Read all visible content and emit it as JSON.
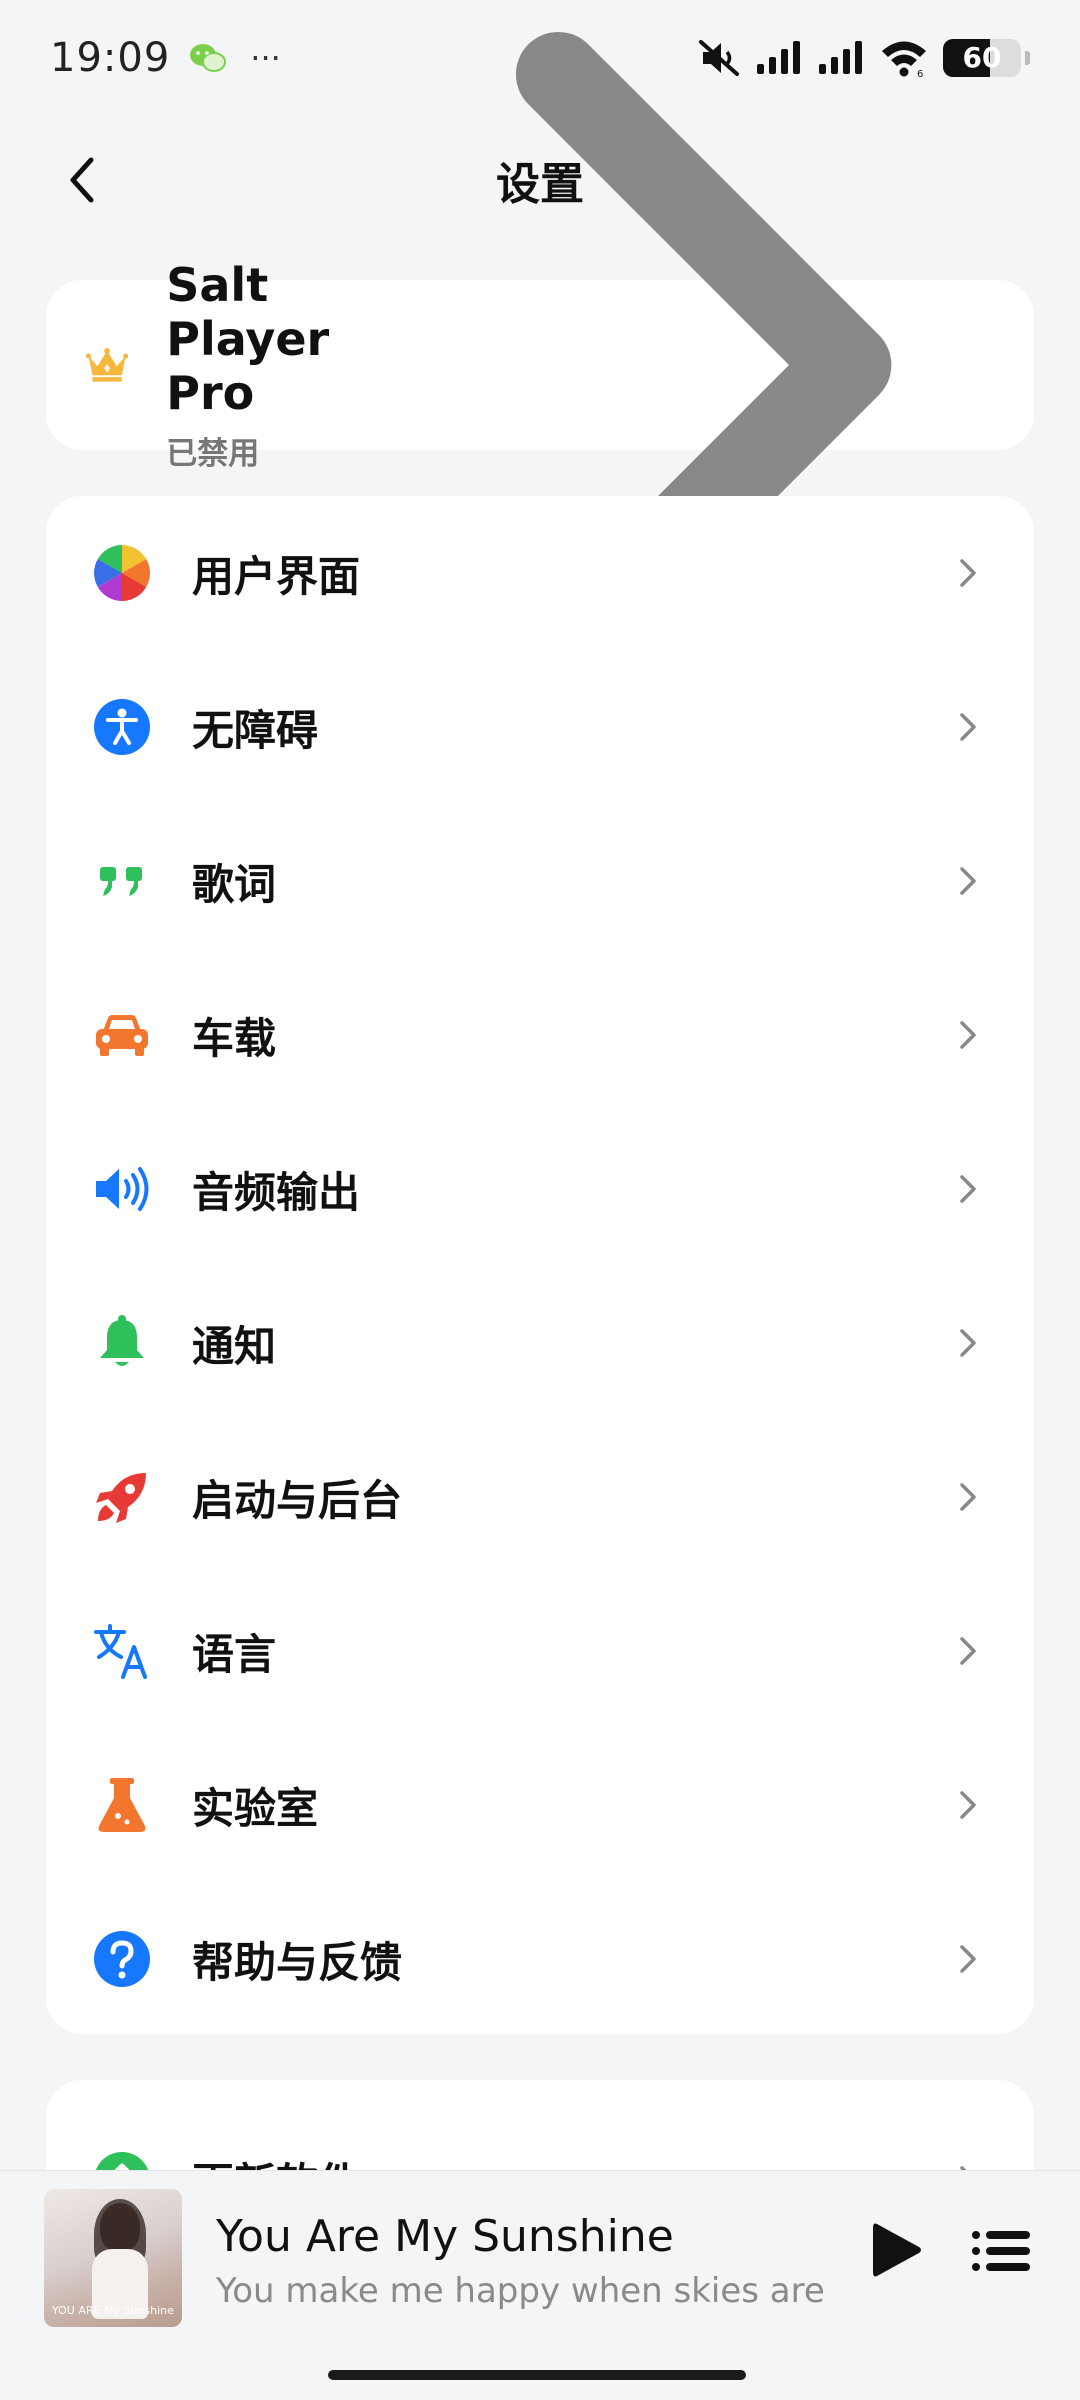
{
  "status_bar": {
    "time": "19:09",
    "notification_icons": [
      "wechat-icon",
      "more-dots-icon"
    ],
    "indicators": [
      "mute-icon",
      "signal-icon",
      "signal-icon",
      "wifi-icon"
    ],
    "battery_level": "60",
    "battery_fraction": 0.6
  },
  "header": {
    "title": "设置"
  },
  "pro": {
    "title": "Salt Player Pro",
    "status": "已禁用",
    "icon": "crown-icon",
    "accent": "#f6b73c"
  },
  "settings": {
    "items": [
      {
        "label": "用户界面",
        "icon": "color-wheel-icon"
      },
      {
        "label": "无障碍",
        "icon": "accessibility-icon",
        "color": "#1677ff"
      },
      {
        "label": "歌词",
        "icon": "quote-icon",
        "color": "#2fbf5b"
      },
      {
        "label": "车载",
        "icon": "car-icon",
        "color": "#f2762e"
      },
      {
        "label": "音频输出",
        "icon": "speaker-icon",
        "color": "#1677ff"
      },
      {
        "label": "通知",
        "icon": "bell-icon",
        "color": "#2fbf5b"
      },
      {
        "label": "启动与后台",
        "icon": "rocket-icon",
        "color": "#e83a35"
      },
      {
        "label": "语言",
        "icon": "translate-icon",
        "color": "#1677ff"
      },
      {
        "label": "实验室",
        "icon": "flask-icon",
        "color": "#f2762e"
      },
      {
        "label": "帮助与反馈",
        "icon": "help-icon",
        "color": "#1677ff"
      }
    ]
  },
  "update": {
    "label": "更新软件",
    "icon": "upload-icon",
    "color": "#2fbf5b"
  },
  "player": {
    "song_title": "You Are My Sunshine",
    "lyric": "You make me happy when skies are",
    "cover_text": "YOU ARE My Sunshine"
  }
}
